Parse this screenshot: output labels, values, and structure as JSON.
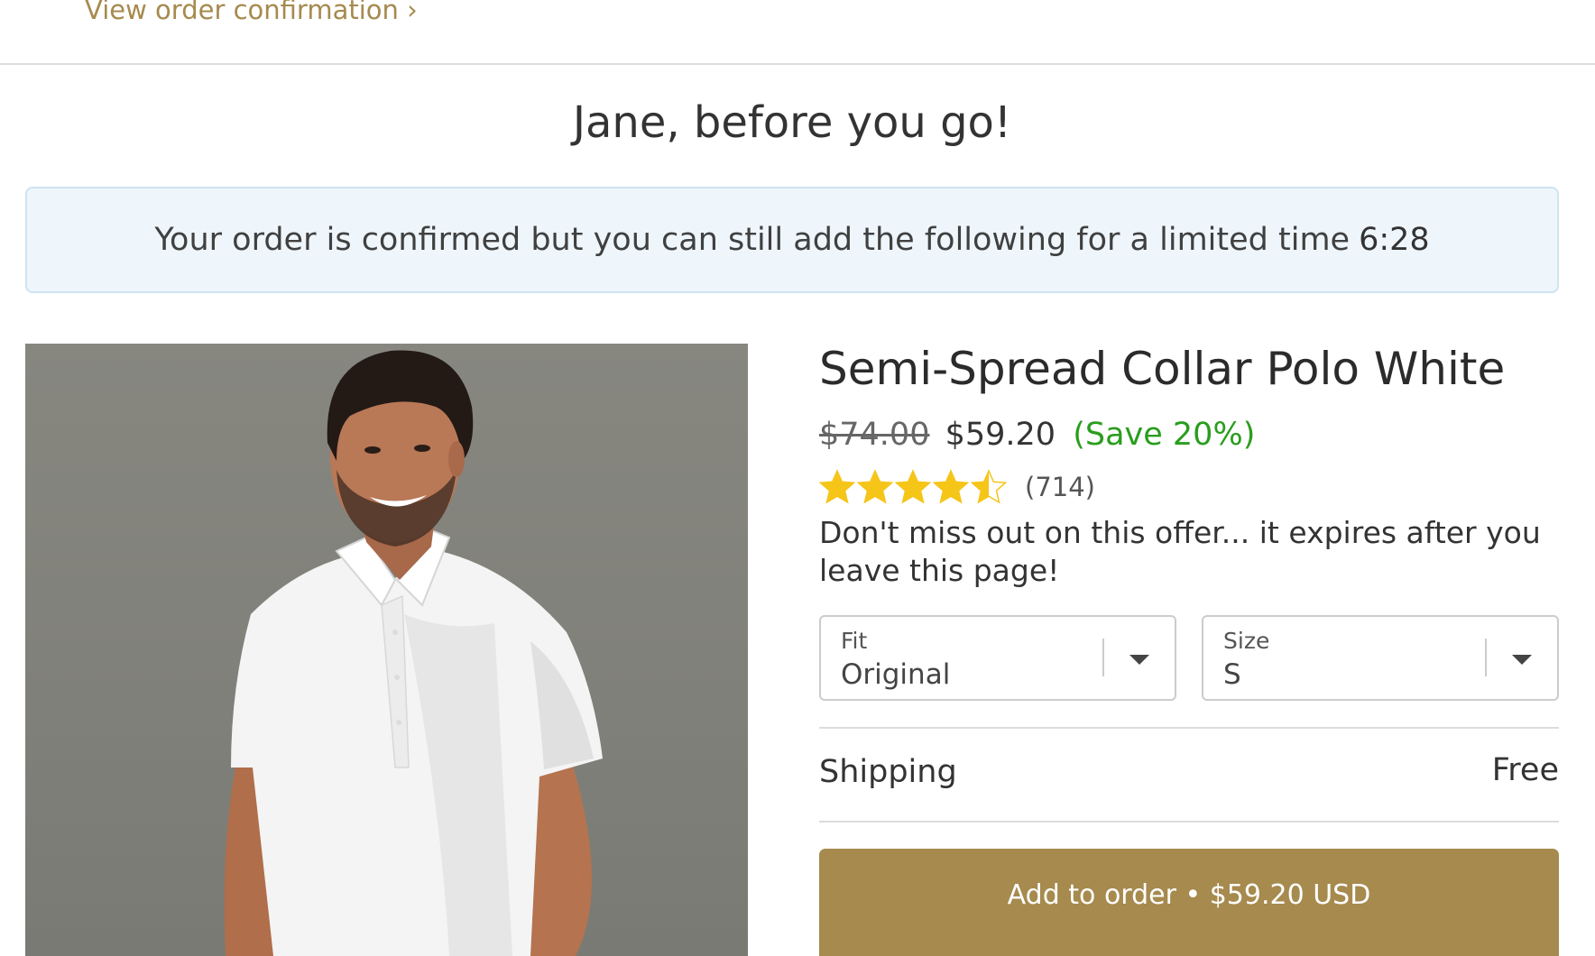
{
  "top_link": {
    "label": "View order confirmation ›"
  },
  "page_title": "Jane, before you go!",
  "notice": {
    "text": "Your order is confirmed but you can still add the following for a limited time",
    "timer": "6:28"
  },
  "product": {
    "image_icon": "product-photo-man-in-white-polo",
    "title": "Semi-Spread Collar Polo White",
    "price_original": "$74.00",
    "price_current": "$59.20",
    "price_save": "(Save 20%)",
    "rating": 4.5,
    "rating_max": 5,
    "review_count": "(714)",
    "offer_text": "Don't miss out on this offer... it expires after you leave this page!",
    "fit": {
      "label": "Fit",
      "value": "Original"
    },
    "size": {
      "label": "Size",
      "value": "S"
    },
    "shipping": {
      "label": "Shipping",
      "value": "Free"
    },
    "add_button_label": "Add to order • $59.20 USD"
  },
  "colors": {
    "accent": "#a68a4e",
    "save_green": "#2a9d1e",
    "star": "#f5c518",
    "notice_bg": "#eef6fc"
  }
}
